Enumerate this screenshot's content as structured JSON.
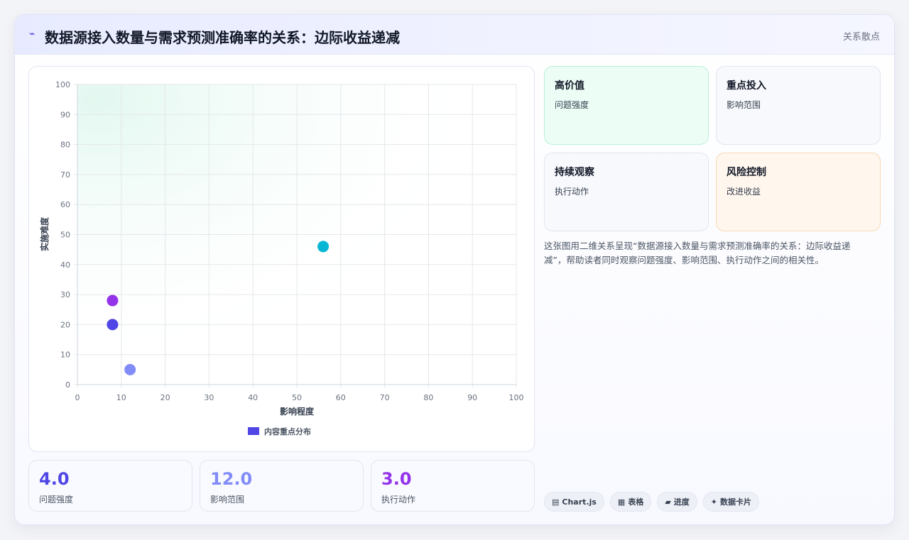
{
  "header": {
    "title": "数据源接入数量与需求预测准确率的关系：边际收益递减",
    "tag": "关系散点"
  },
  "chart_data": {
    "type": "scatter",
    "xlabel": "影响程度",
    "ylabel": "实施难度",
    "xlim": [
      0,
      100
    ],
    "ylim": [
      0,
      100
    ],
    "xticks": [
      0,
      10,
      20,
      30,
      40,
      50,
      60,
      70,
      80,
      90,
      100
    ],
    "yticks": [
      0,
      10,
      20,
      30,
      40,
      50,
      60,
      70,
      80,
      90,
      100
    ],
    "grid": true,
    "legend_position": "bottom",
    "series": [
      {
        "name": "内容重点分布",
        "legend_color": "#4f46e5",
        "points": [
          {
            "x": 8,
            "y": 20,
            "color": "#4f46e5"
          },
          {
            "x": 12,
            "y": 5,
            "color": "#818cf8"
          },
          {
            "x": 8,
            "y": 28,
            "color": "#9333ea"
          },
          {
            "x": 56,
            "y": 46,
            "color": "#06b6d4"
          }
        ]
      }
    ]
  },
  "stats": [
    {
      "value": "4.0",
      "label": "问题强度",
      "color": "#4f46e5"
    },
    {
      "value": "12.0",
      "label": "影响范围",
      "color": "#818cf8"
    },
    {
      "value": "3.0",
      "label": "执行动作",
      "color": "#9333ea"
    }
  ],
  "quadrants": [
    {
      "title": "高价值",
      "subtitle": "问题强度",
      "bg": "#ecfdf5",
      "border": "#bbf0d6"
    },
    {
      "title": "重点投入",
      "subtitle": "影响范围",
      "bg": "#f8f9fc",
      "border": "#e2e5f1"
    },
    {
      "title": "持续观察",
      "subtitle": "执行动作",
      "bg": "#f8f9fc",
      "border": "#e2e5f1"
    },
    {
      "title": "风险控制",
      "subtitle": "改进收益",
      "bg": "#fff7ed",
      "border": "#fad7b5"
    }
  ],
  "description": "这张图用二维关系呈现“数据源接入数量与需求预测准确率的关系：边际收益递减”，帮助读者同时观察问题强度、影响范围、执行动作之间的相关性。",
  "badges": [
    {
      "icon": "▤",
      "icon_name": "chart-icon",
      "label": "Chart.js"
    },
    {
      "icon": "▦",
      "icon_name": "table-icon",
      "label": "表格"
    },
    {
      "icon": "▰",
      "icon_name": "progress-icon",
      "label": "进度"
    },
    {
      "icon": "✦",
      "icon_name": "sparkle-icon",
      "label": "数据卡片"
    }
  ]
}
